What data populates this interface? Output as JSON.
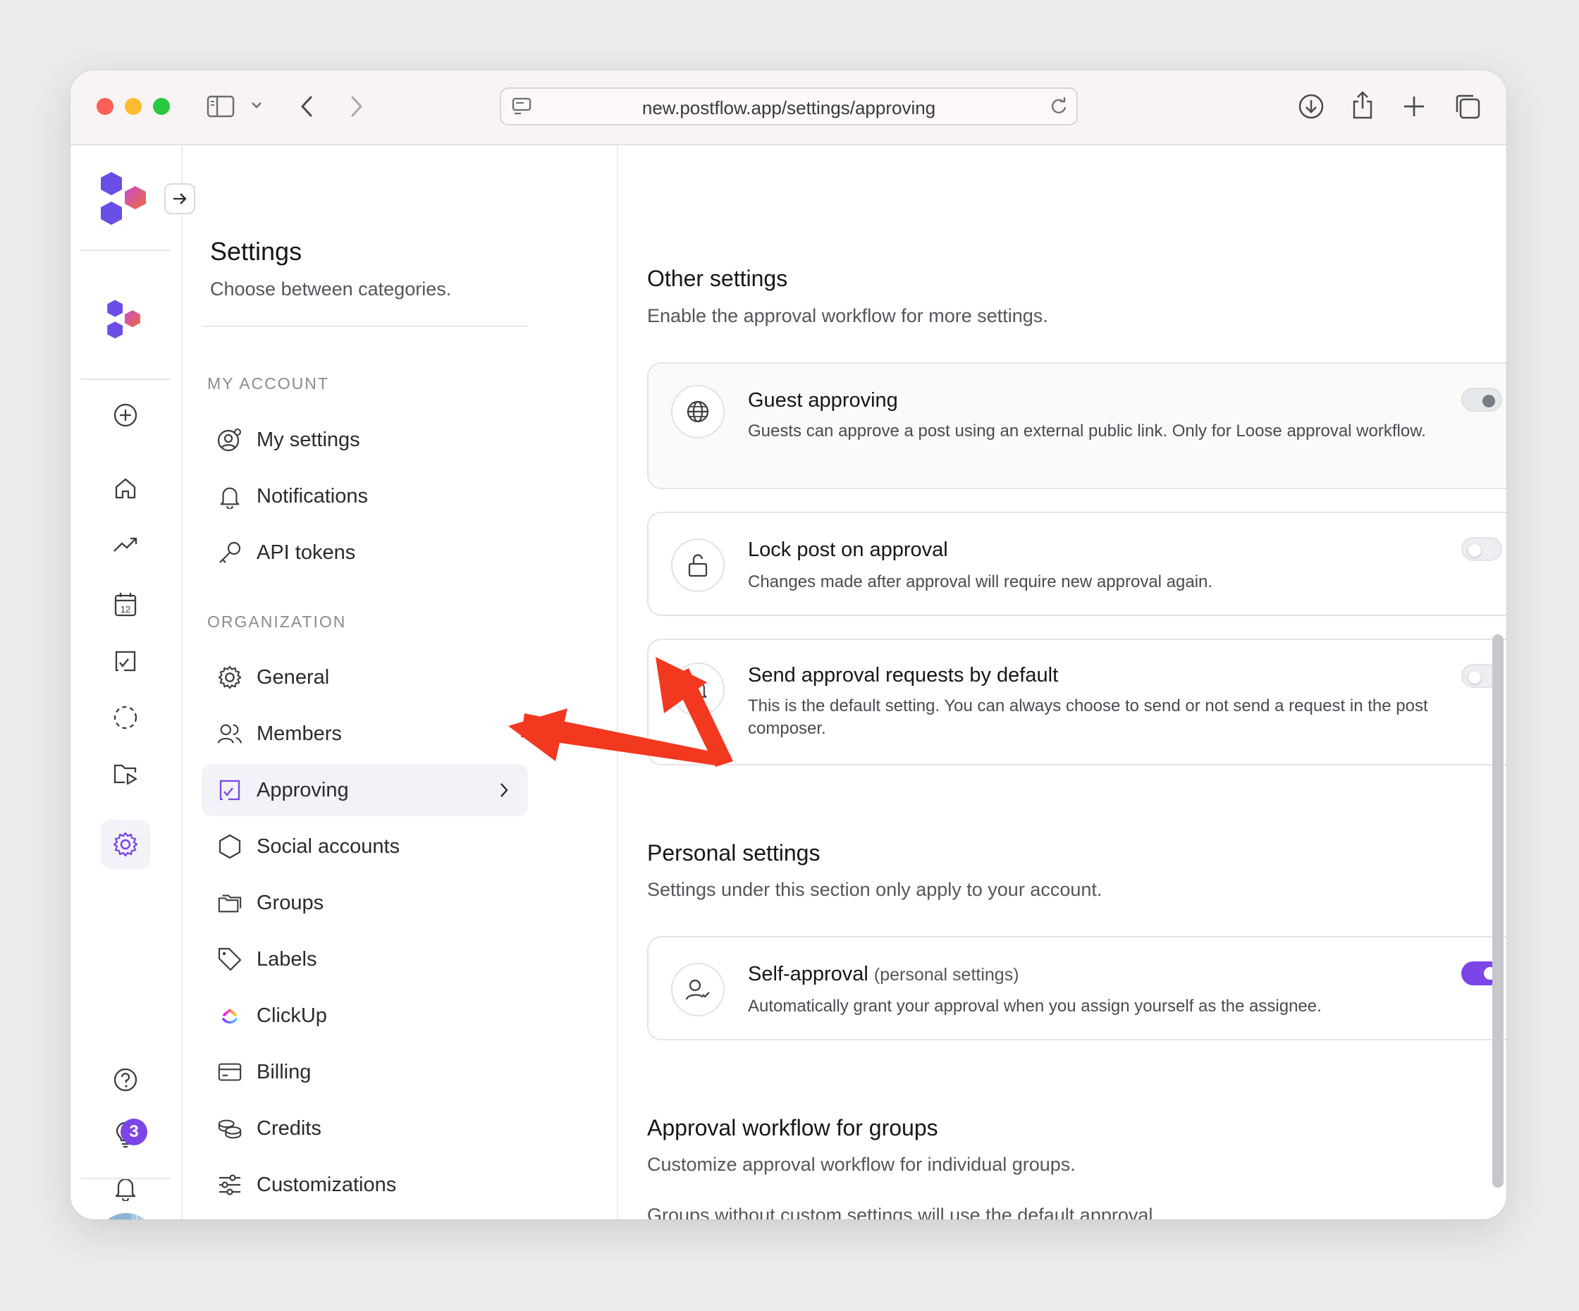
{
  "browser": {
    "url": "new.postflow.app/settings/approving"
  },
  "rail": {
    "notifications_badge": "3",
    "icons": [
      "plus-circle-icon",
      "home-icon",
      "trending-icon",
      "calendar-icon",
      "approve-icon",
      "dashed-circle-icon",
      "media-folder-icon",
      "settings-icon",
      "help-icon",
      "bulb-icon",
      "bell-icon"
    ],
    "calendar_day": "12"
  },
  "sidebar": {
    "title": "Settings",
    "subtitle": "Choose between categories.",
    "my_account_label": "MY ACCOUNT",
    "my_account_items": [
      {
        "label": "My settings"
      },
      {
        "label": "Notifications"
      },
      {
        "label": "API tokens"
      }
    ],
    "organization_label": "ORGANIZATION",
    "organization_items": [
      {
        "label": "General"
      },
      {
        "label": "Members"
      },
      {
        "label": "Approving"
      },
      {
        "label": "Social accounts"
      },
      {
        "label": "Groups"
      },
      {
        "label": "Labels"
      },
      {
        "label": "ClickUp"
      },
      {
        "label": "Billing"
      },
      {
        "label": "Credits"
      },
      {
        "label": "Customizations"
      }
    ]
  },
  "main": {
    "other": {
      "title": "Other settings",
      "subtitle": "Enable the approval workflow for more settings.",
      "cards": [
        {
          "title": "Guest approving",
          "desc": "Guests can approve a post using an external public link. Only for Loose approval workflow.",
          "toggle": "disabled"
        },
        {
          "title": "Lock post on approval",
          "desc": "Changes made after approval will require new approval again.",
          "toggle": "off"
        },
        {
          "title": "Send approval requests by default",
          "desc": "This is the default setting. You can always choose to send or not send a request in the post composer.",
          "toggle": "off"
        }
      ]
    },
    "personal": {
      "title": "Personal settings",
      "subtitle": "Settings under this section only apply to your account.",
      "card": {
        "title": "Self-approval",
        "tag": "(personal settings)",
        "desc": "Automatically grant your approval when you assign yourself as the assignee.",
        "toggle": "on"
      }
    },
    "groups": {
      "title": "Approval workflow for groups",
      "subtitle": "Customize approval workflow for individual groups.",
      "note": "Groups without custom settings will use the default approval workflow for the organization."
    }
  },
  "colors": {
    "accent": "#7b45e8",
    "arrow": "#f2381f",
    "logo_purple": "#6a4ee6",
    "logo_orange": "#f25c3a"
  }
}
